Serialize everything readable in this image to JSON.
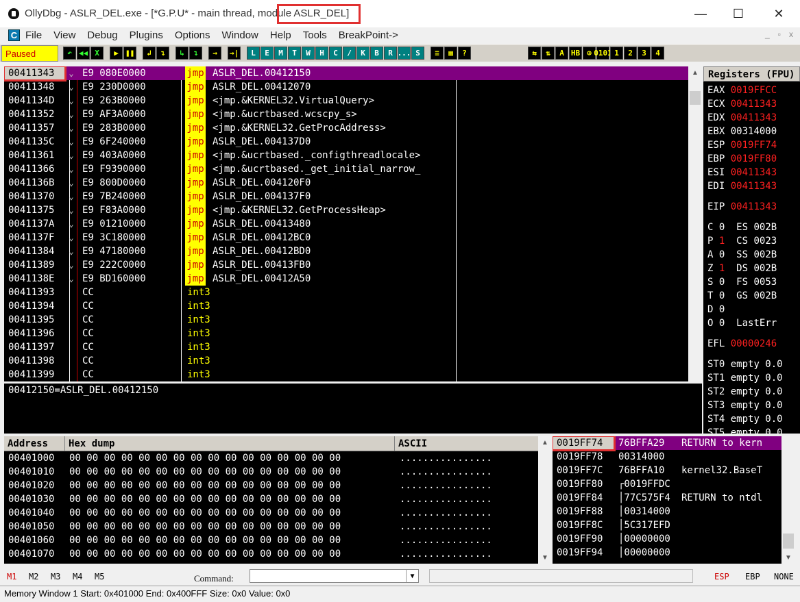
{
  "window": {
    "title_prefix": "OllyDbg - ASLR_DEL.exe - [*G.P.U* - main thread, modu",
    "title_module": "le ASLR_DEL]",
    "minimize": "—",
    "maximize": "☐",
    "close": "✕"
  },
  "menu": {
    "app_icon_letter": "C",
    "items": [
      "File",
      "View",
      "Debug",
      "Plugins",
      "Options",
      "Window",
      "Help",
      "Tools",
      "BreakPoint->"
    ],
    "mdi": [
      "_",
      "▫",
      "x"
    ]
  },
  "toolbar": {
    "status": "Paused",
    "buttons_group1": [
      "↶",
      "◀◀",
      "X"
    ],
    "buttons_group2": [
      "▶",
      "❚❚"
    ],
    "buttons_group3": [
      "↲",
      "↴"
    ],
    "buttons_group4": [
      "↳",
      "↴"
    ],
    "buttons_group5": [
      "→"
    ],
    "buttons_group6": [
      "→|"
    ],
    "letters": [
      "L",
      "E",
      "M",
      "T",
      "W",
      "H",
      "C",
      "/",
      "K",
      "B",
      "R",
      "...",
      "S"
    ],
    "buttons_group7": [
      "≡",
      "▦",
      "?"
    ],
    "right_buttons": [
      "⇆",
      "⇅",
      "A",
      "HB",
      "⊕",
      "0101",
      "1",
      "2",
      "3",
      "4"
    ]
  },
  "disasm": {
    "rows": [
      {
        "addr": "00411343",
        "arrow": "⌄",
        "hex": "E9 080E0000",
        "mnem": "jmp",
        "op": "ASLR_DEL.00412150",
        "selected": true
      },
      {
        "addr": "00411348",
        "arrow": "⌄",
        "hex": "E9 230D0000",
        "mnem": "jmp",
        "op": "ASLR_DEL.00412070"
      },
      {
        "addr": "0041134D",
        "arrow": "⌄",
        "hex": "E9 263B0000",
        "mnem": "jmp",
        "op": "<jmp.&KERNEL32.VirtualQuery>"
      },
      {
        "addr": "00411352",
        "arrow": "⌄",
        "hex": "E9 AF3A0000",
        "mnem": "jmp",
        "op": "<jmp.&ucrtbased.wcscpy_s>"
      },
      {
        "addr": "00411357",
        "arrow": "⌄",
        "hex": "E9 283B0000",
        "mnem": "jmp",
        "op": "<jmp.&KERNEL32.GetProcAddress>"
      },
      {
        "addr": "0041135C",
        "arrow": "⌄",
        "hex": "E9 6F240000",
        "mnem": "jmp",
        "op": "ASLR_DEL.004137D0"
      },
      {
        "addr": "00411361",
        "arrow": "⌄",
        "hex": "E9 403A0000",
        "mnem": "jmp",
        "op": "<jmp.&ucrtbased._configthreadlocale>"
      },
      {
        "addr": "00411366",
        "arrow": "⌄",
        "hex": "E9 F9390000",
        "mnem": "jmp",
        "op": "<jmp.&ucrtbased._get_initial_narrow_"
      },
      {
        "addr": "0041136B",
        "arrow": "⌄",
        "hex": "E9 800D0000",
        "mnem": "jmp",
        "op": "ASLR_DEL.004120F0"
      },
      {
        "addr": "00411370",
        "arrow": "⌄",
        "hex": "E9 7B240000",
        "mnem": "jmp",
        "op": "ASLR_DEL.004137F0"
      },
      {
        "addr": "00411375",
        "arrow": "⌄",
        "hex": "E9 F83A0000",
        "mnem": "jmp",
        "op": "<jmp.&KERNEL32.GetProcessHeap>"
      },
      {
        "addr": "0041137A",
        "arrow": "⌄",
        "hex": "E9 01210000",
        "mnem": "jmp",
        "op": "ASLR_DEL.00413480"
      },
      {
        "addr": "0041137F",
        "arrow": "⌄",
        "hex": "E9 3C180000",
        "mnem": "jmp",
        "op": "ASLR_DEL.00412BC0"
      },
      {
        "addr": "00411384",
        "arrow": "⌄",
        "hex": "E9 47180000",
        "mnem": "jmp",
        "op": "ASLR_DEL.00412BD0"
      },
      {
        "addr": "00411389",
        "arrow": "⌄",
        "hex": "E9 222C0000",
        "mnem": "jmp",
        "op": "ASLR_DEL.00413FB0"
      },
      {
        "addr": "0041138E",
        "arrow": "⌄",
        "hex": "E9 BD160000",
        "mnem": "jmp",
        "op": "ASLR_DEL.00412A50"
      },
      {
        "addr": "00411393",
        "arrow": "",
        "hex": "CC",
        "mnem": "int3",
        "op": ""
      },
      {
        "addr": "00411394",
        "arrow": "",
        "hex": "CC",
        "mnem": "int3",
        "op": ""
      },
      {
        "addr": "00411395",
        "arrow": "",
        "hex": "CC",
        "mnem": "int3",
        "op": ""
      },
      {
        "addr": "00411396",
        "arrow": "",
        "hex": "CC",
        "mnem": "int3",
        "op": ""
      },
      {
        "addr": "00411397",
        "arrow": "",
        "hex": "CC",
        "mnem": "int3",
        "op": ""
      },
      {
        "addr": "00411398",
        "arrow": "",
        "hex": "CC",
        "mnem": "int3",
        "op": ""
      },
      {
        "addr": "00411399",
        "arrow": "",
        "hex": "CC",
        "mnem": "int3",
        "op": ""
      }
    ]
  },
  "info": {
    "text": "00412150=ASLR_DEL.00412150"
  },
  "registers": {
    "header": "Registers (FPU)",
    "gp": [
      {
        "name": "EAX",
        "val": "0019FFCC",
        "red": true
      },
      {
        "name": "ECX",
        "val": "00411343",
        "red": true
      },
      {
        "name": "EDX",
        "val": "00411343",
        "red": true
      },
      {
        "name": "EBX",
        "val": "00314000",
        "red": false
      },
      {
        "name": "ESP",
        "val": "0019FF74",
        "red": true
      },
      {
        "name": "EBP",
        "val": "0019FF80",
        "red": true
      },
      {
        "name": "ESI",
        "val": "00411343",
        "red": true
      },
      {
        "name": "EDI",
        "val": "00411343",
        "red": true
      }
    ],
    "eip": {
      "name": "EIP",
      "val": "00411343"
    },
    "flags": [
      {
        "f": "C",
        "v": "0",
        "red": false,
        "seg": "ES",
        "sv": "002B"
      },
      {
        "f": "P",
        "v": "1",
        "red": true,
        "seg": "CS",
        "sv": "0023"
      },
      {
        "f": "A",
        "v": "0",
        "red": false,
        "seg": "SS",
        "sv": "002B"
      },
      {
        "f": "Z",
        "v": "1",
        "red": true,
        "seg": "DS",
        "sv": "002B"
      },
      {
        "f": "S",
        "v": "0",
        "red": false,
        "seg": "FS",
        "sv": "0053"
      },
      {
        "f": "T",
        "v": "0",
        "red": false,
        "seg": "GS",
        "sv": "002B"
      },
      {
        "f": "D",
        "v": "0",
        "red": false,
        "seg": "",
        "sv": ""
      },
      {
        "f": "O",
        "v": "0",
        "red": false,
        "seg": "LastErr",
        "sv": ""
      }
    ],
    "efl": {
      "name": "EFL",
      "val": "00000246"
    },
    "fpu": [
      {
        "name": "ST0",
        "text": "empty 0.0"
      },
      {
        "name": "ST1",
        "text": "empty 0.0"
      },
      {
        "name": "ST2",
        "text": "empty 0.0"
      },
      {
        "name": "ST3",
        "text": "empty 0.0"
      },
      {
        "name": "ST4",
        "text": "empty 0.0"
      },
      {
        "name": "ST5",
        "text": "empty 0.0"
      }
    ]
  },
  "dump": {
    "headers": {
      "address": "Address",
      "hex": "Hex dump",
      "ascii": "ASCII"
    },
    "rows": [
      {
        "addr": "00401000",
        "hex": "00 00 00 00 00 00 00 00 00 00 00 00 00 00 00 00",
        "ascii": "................"
      },
      {
        "addr": "00401010",
        "hex": "00 00 00 00 00 00 00 00 00 00 00 00 00 00 00 00",
        "ascii": "................"
      },
      {
        "addr": "00401020",
        "hex": "00 00 00 00 00 00 00 00 00 00 00 00 00 00 00 00",
        "ascii": "................"
      },
      {
        "addr": "00401030",
        "hex": "00 00 00 00 00 00 00 00 00 00 00 00 00 00 00 00",
        "ascii": "................"
      },
      {
        "addr": "00401040",
        "hex": "00 00 00 00 00 00 00 00 00 00 00 00 00 00 00 00",
        "ascii": "................"
      },
      {
        "addr": "00401050",
        "hex": "00 00 00 00 00 00 00 00 00 00 00 00 00 00 00 00",
        "ascii": "................"
      },
      {
        "addr": "00401060",
        "hex": "00 00 00 00 00 00 00 00 00 00 00 00 00 00 00 00",
        "ascii": "................"
      },
      {
        "addr": "00401070",
        "hex": "00 00 00 00 00 00 00 00 00 00 00 00 00 00 00 00",
        "ascii": "................"
      }
    ]
  },
  "stack": {
    "rows": [
      {
        "addr": "0019FF74",
        "val": "76BFFA29",
        "comment": "RETURN to kern",
        "top": true
      },
      {
        "addr": "0019FF78",
        "val": "00314000",
        "comment": ""
      },
      {
        "addr": "0019FF7C",
        "val": "76BFFA10",
        "comment": "kernel32.BaseT"
      },
      {
        "addr": "0019FF80",
        "val": "┌0019FFDC",
        "comment": ""
      },
      {
        "addr": "0019FF84",
        "val": "│77C575F4",
        "comment": "RETURN to ntdl"
      },
      {
        "addr": "0019FF88",
        "val": "│00314000",
        "comment": ""
      },
      {
        "addr": "0019FF8C",
        "val": "│5C317EFD",
        "comment": ""
      },
      {
        "addr": "0019FF90",
        "val": "│00000000",
        "comment": ""
      },
      {
        "addr": "0019FF94",
        "val": "│00000000",
        "comment": ""
      }
    ]
  },
  "command": {
    "marks": [
      "M1",
      "M2",
      "M3",
      "M4",
      "M5"
    ],
    "label": "Command:",
    "value": "",
    "right": [
      "ESP",
      "EBP",
      "NONE"
    ]
  },
  "statusbar": {
    "text": "Memory Window 1  Start:  0x401000  End:  0x400FFF  Size:  0x0 Value:  0x0"
  }
}
